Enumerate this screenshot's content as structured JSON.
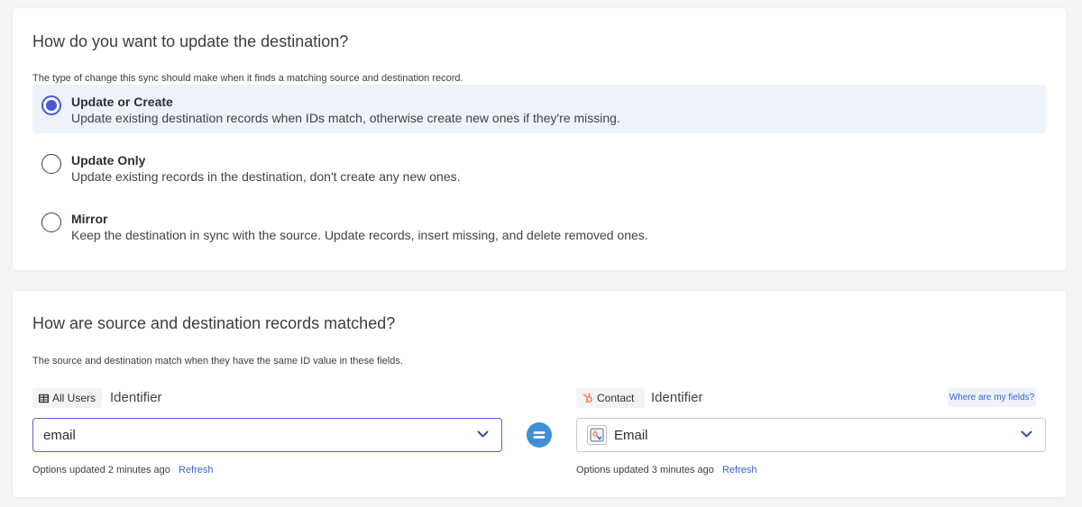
{
  "update_section": {
    "title": "How do you want to update the destination?",
    "subtitle": "The type of change this sync should make when it finds a matching source and destination record.",
    "selected_option": "Update or Create",
    "options": [
      {
        "title": "Update or Create",
        "description": "Update existing destination records when IDs match, otherwise create new ones if they're missing."
      },
      {
        "title": "Update Only",
        "description": "Update existing records in the destination, don't create any new ones."
      },
      {
        "title": "Mirror",
        "description": "Keep the destination in sync with the source. Update records, insert missing, and delete removed ones."
      }
    ]
  },
  "match_section": {
    "title": "How are source and destination records matched?",
    "subtitle": "The source and destination match when they have the same ID value in these fields.",
    "source": {
      "model_label": "All Users",
      "model_icon": "table-icon",
      "identifier_label": "Identifier",
      "selected_value": "email",
      "options_status": "Options updated 2 minutes ago",
      "refresh_label": "Refresh"
    },
    "equals_icon": "equals-icon",
    "destination": {
      "object_label": "Contact",
      "object_icon": "hubspot-icon",
      "identifier_label": "Identifier",
      "help_label": "Where are my fields?",
      "selected_value": "Email",
      "field_icon": "field-type-icon",
      "options_status": "Options updated 3 minutes ago",
      "refresh_label": "Refresh"
    }
  },
  "colors": {
    "accent": "#4a55d8",
    "selected_bg": "#edf2fb",
    "link": "#3566c5",
    "equals_badge": "#3e8fd6",
    "hubspot": "#ff7a59"
  }
}
